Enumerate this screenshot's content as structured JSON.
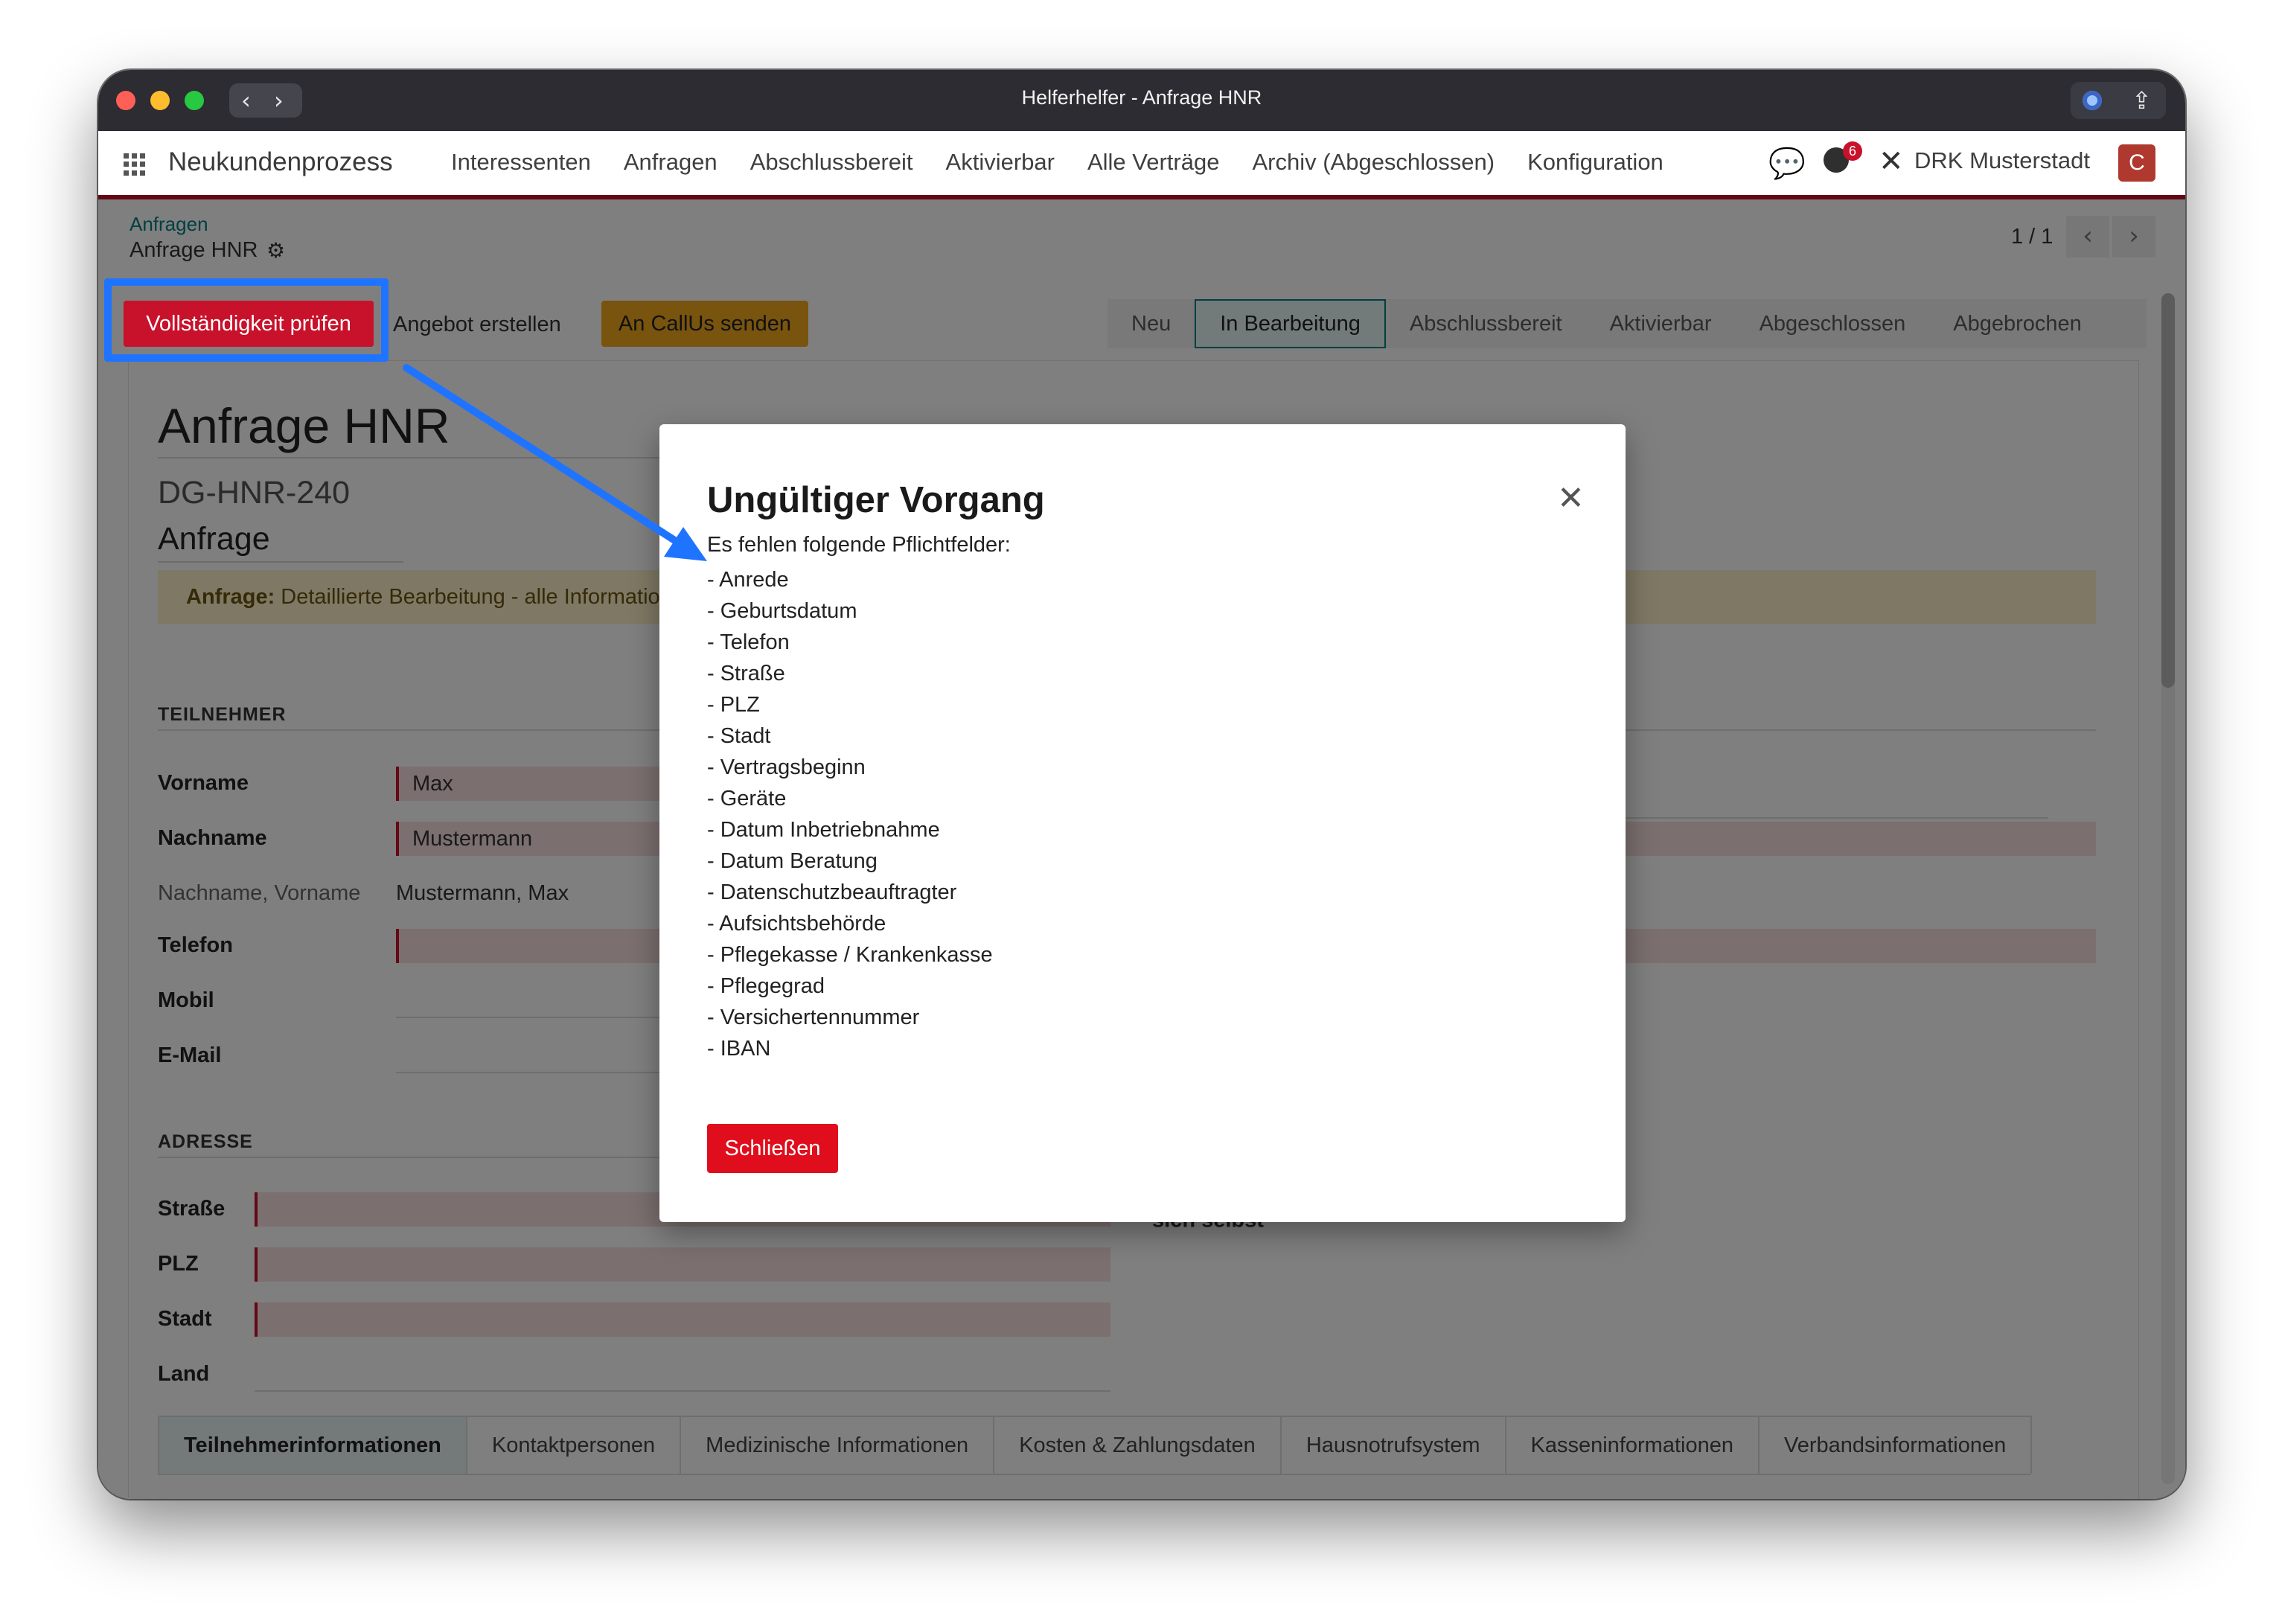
{
  "window": {
    "title": "Helferhelfer - Anfrage HNR"
  },
  "navbar": {
    "brand": "Neukundenprozess",
    "menu": [
      "Interessenten",
      "Anfragen",
      "Abschlussbereit",
      "Aktivierbar",
      "Alle Verträge",
      "Archiv (Abgeschlossen)",
      "Konfiguration"
    ],
    "activity_count": "6",
    "company": "DRK Musterstadt",
    "avatar_letter": "C"
  },
  "breadcrumb": {
    "parent": "Anfragen",
    "current": "Anfrage HNR"
  },
  "pager": {
    "value": "1 / 1"
  },
  "actions": {
    "check": "Vollständigkeit prüfen",
    "offer": "Angebot erstellen",
    "callus": "An CallUs senden"
  },
  "statusbar": {
    "stages": [
      "Neu",
      "In Bearbeitung",
      "Abschlussbereit",
      "Aktivierbar",
      "Abgeschlossen",
      "Abgebrochen"
    ],
    "active": "In Bearbeitung"
  },
  "record": {
    "title": "Anfrage HNR",
    "reference": "DG-HNR-240",
    "type": "Anfrage",
    "alert_label": "Anfrage:",
    "alert_text": "Detaillierte Bearbeitung - alle Informationen"
  },
  "participant": {
    "section": "TEILNEHMER",
    "vorname_label": "Vorname",
    "vorname": "Max",
    "nachname_label": "Nachname",
    "nachname": "Mustermann",
    "fullname_label": "Nachname, Vorname",
    "fullname": "Mustermann, Max",
    "telefon_label": "Telefon",
    "mobil_label": "Mobil",
    "email_label": "E-Mail"
  },
  "address": {
    "section": "ADRESSE",
    "strasse_label": "Straße",
    "plz_label": "PLZ",
    "stadt_label": "Stadt",
    "land_label": "Land",
    "self_label": "sich selbst",
    "help_marker": "?"
  },
  "tabs": [
    "Teilnehmerinformationen",
    "Kontaktpersonen",
    "Medizinische Informationen",
    "Kosten & Zahlungsdaten",
    "Hausnotrufsystem",
    "Kasseninformationen",
    "Verbandsinformationen"
  ],
  "dialog": {
    "title": "Ungültiger Vorgang",
    "intro": "Es fehlen folgende Pflichtfelder:",
    "missing": [
      "- Anrede",
      "- Geburtsdatum",
      "- Telefon",
      "- Straße",
      "- PLZ",
      "- Stadt",
      "- Vertragsbeginn",
      "- Geräte",
      "- Datum Inbetriebnahme",
      "- Datum Beratung",
      "- Datenschutzbeauftragter",
      "- Aufsichtsbehörde",
      "- Pflegekasse / Krankenkasse",
      "- Pflegegrad",
      "- Versichertennummer",
      "- IBAN"
    ],
    "close_button": "Schließen"
  },
  "colors": {
    "accent": "#c8112a",
    "annotation": "#1f74ff",
    "teal": "#017e84",
    "warning": "#f0a81c"
  }
}
